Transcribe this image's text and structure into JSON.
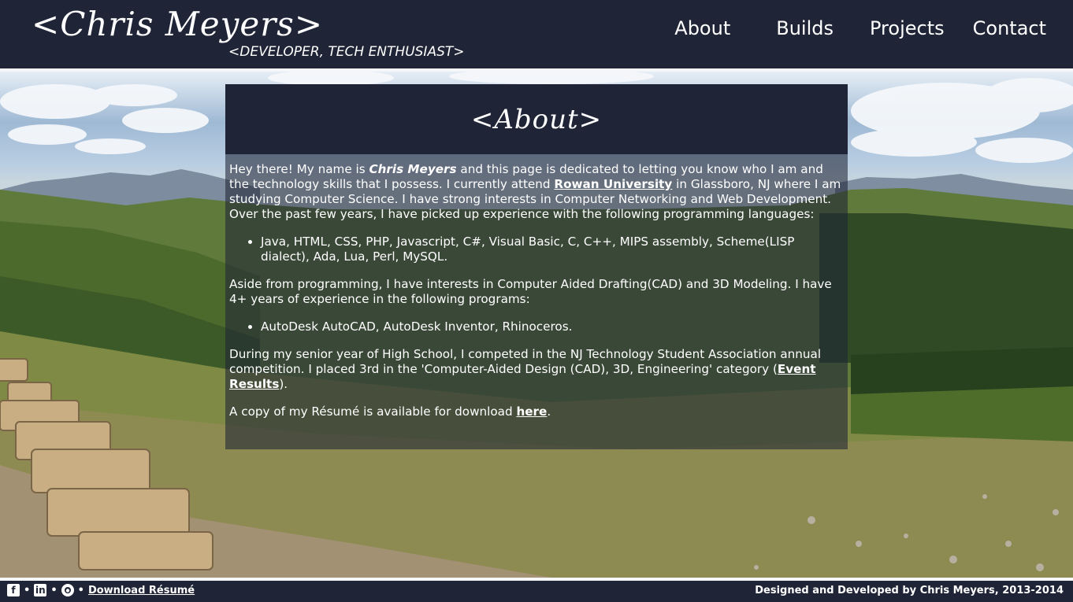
{
  "header": {
    "logo": "<Chris Meyers>",
    "tagline": "<DEVELOPER, TECH ENTHUSIAST>",
    "nav": [
      "About",
      "Builds",
      "Projects",
      "Contact"
    ]
  },
  "panel": {
    "title": "<About>",
    "intro": {
      "before_name": "Hey there! My name is ",
      "name": "Chris Meyers",
      "after_name": " and this page is dedicated to letting you know who I am and the technology skills that I possess. I currently attend ",
      "university_link": "Rowan University",
      "after_link": " in Glassboro, NJ where I am studying Computer Science. I have strong interests in Computer Networking and Web Development. Over the past few years, I have picked up experience with the following programming languages:"
    },
    "languages": "Java, HTML, CSS, PHP, Javascript, C#, Visual Basic, C, C++, MIPS assembly, Scheme(LISP dialect), Ada, Lua, Perl, MySQL.",
    "cad_text": "Aside from programming, I have interests in Computer Aided Drafting(CAD) and 3D Modeling. I have 4+ years of experience in the following programs:",
    "cad_programs": "AutoDesk AutoCAD, AutoDesk Inventor, Rhinoceros.",
    "tsa": {
      "text": "During my senior year of High School, I competed in the NJ Technology Student Association annual competition. I placed 3rd in the 'Computer-Aided Design (CAD), 3D, Engineering' category (",
      "link": "Event Results",
      "after": ")."
    },
    "resume": {
      "text": "A copy of my Résumé is available for download ",
      "link": "here",
      "after": "."
    }
  },
  "footer": {
    "icons": [
      "facebook-icon",
      "linkedin-icon",
      "github-icon"
    ],
    "separator": "•",
    "download_link": "Download Résumé",
    "credit": "Designed and Developed by Chris Meyers, 2013-2014"
  },
  "colors": {
    "header_bg": "#1f2536",
    "text": "#ffffff"
  }
}
